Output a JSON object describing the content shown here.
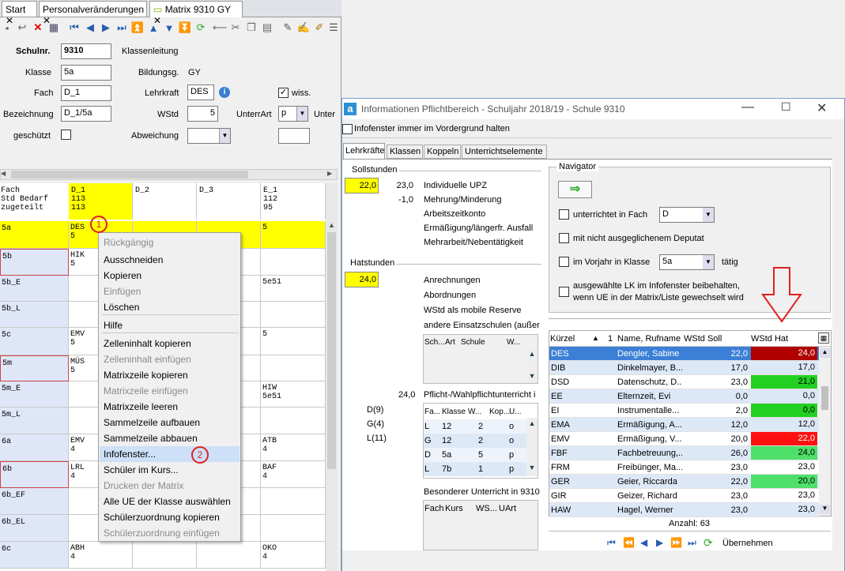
{
  "tabs": [
    "Start",
    "Personalveränderungen",
    "Matrix 9310 GY"
  ],
  "form": {
    "schulnr_label": "Schulnr.",
    "schulnr": "9310",
    "klassenleitung": "Klassenleitung",
    "klasse_label": "Klasse",
    "klasse": "5a",
    "bildungsg_label": "Bildungsg.",
    "bildungsg": "GY",
    "fach_label": "Fach",
    "fach": "D_1",
    "lehrkraft_label": "Lehrkraft",
    "lehrkraft": "DES",
    "wiss": "wiss.",
    "bezeichnung_label": "Bezeichnung",
    "bezeichnung": "D_1/5a",
    "wstd_label": "WStd",
    "wstd": "5",
    "unterart_label": "UnterrArt",
    "unterart": "p",
    "unter_cut": "Unter",
    "geschuetzt_label": "geschützt",
    "abweichung_label": "Abweichung"
  },
  "matrix": {
    "row_header": [
      "Fach",
      "Std Bedarf",
      "zugeteilt"
    ],
    "columns": [
      {
        "name": "D_1",
        "bedarf": "113",
        "zugeteilt": "113"
      },
      {
        "name": "D_2",
        "bedarf": "",
        "zugeteilt": ""
      },
      {
        "name": "D_3",
        "bedarf": "",
        "zugeteilt": ""
      },
      {
        "name": "E_1",
        "bedarf": "112",
        "zugeteilt": "95"
      }
    ],
    "rows": [
      {
        "k": "5a",
        "c1a": "DES",
        "c1b": "5",
        "c4a": "5",
        "c4b": ""
      },
      {
        "k": "5b",
        "c1a": "HIK",
        "c1b": "5",
        "c4a": "",
        "c4b": ""
      },
      {
        "k": "5b_E",
        "c1a": "",
        "c1b": "",
        "c4a": "5e51",
        "c4b": ""
      },
      {
        "k": "5b_L",
        "c1a": "",
        "c1b": "",
        "c4a": "",
        "c4b": ""
      },
      {
        "k": "5c",
        "c1a": "EMV",
        "c1b": "5",
        "c4a": "5",
        "c4b": ""
      },
      {
        "k": "5m",
        "c1a": "MÜS",
        "c1b": "5",
        "c4a": "",
        "c4b": ""
      },
      {
        "k": "5m_E",
        "c1a": "",
        "c1b": "",
        "c4a": "HIW",
        "c4b": "5e51"
      },
      {
        "k": "5m_L",
        "c1a": "",
        "c1b": "",
        "c4a": "",
        "c4b": ""
      },
      {
        "k": "6a",
        "c1a": "EMV",
        "c1b": "4",
        "c4a": "ATB",
        "c4b": "4"
      },
      {
        "k": "6b",
        "c1a": "LRL",
        "c1b": "4",
        "c4a": "BAF",
        "c4b": "4"
      },
      {
        "k": "6b_EF",
        "c1a": "",
        "c1b": "",
        "c4a": "",
        "c4b": ""
      },
      {
        "k": "6b_EL",
        "c1a": "",
        "c1b": "",
        "c4a": "",
        "c4b": ""
      },
      {
        "k": "6c",
        "c1a": "ABH",
        "c1b": "4",
        "c4a": "OKO",
        "c4b": "4"
      }
    ]
  },
  "context_menu": [
    {
      "label": "Rückgängig",
      "disabled": true
    },
    {
      "label": "Ausschneiden",
      "disabled": false
    },
    {
      "label": "Kopieren",
      "disabled": false
    },
    {
      "label": "Einfügen",
      "disabled": true
    },
    {
      "label": "Löschen",
      "disabled": false
    },
    {
      "label": "Hilfe",
      "disabled": false
    },
    {
      "label": "Zelleninhalt kopieren",
      "disabled": false
    },
    {
      "label": "Zelleninhalt einfügen",
      "disabled": true
    },
    {
      "label": "Matrixzeile kopieren",
      "disabled": false
    },
    {
      "label": "Matrixzeile einfügen",
      "disabled": true
    },
    {
      "label": "Matrixzeile leeren",
      "disabled": false
    },
    {
      "label": "Sammelzeile aufbauen",
      "disabled": false
    },
    {
      "label": "Sammelzeile abbauen",
      "disabled": false
    },
    {
      "label": "Infofenster...",
      "disabled": false
    },
    {
      "label": "Schüler im Kurs...",
      "disabled": false
    },
    {
      "label": "Drucken der Matrix",
      "disabled": true
    },
    {
      "label": "Alle UE der Klasse auswählen",
      "disabled": false
    },
    {
      "label": "Schülerzuordnung kopieren",
      "disabled": false
    },
    {
      "label": "Schülerzuordnung einfügen",
      "disabled": true
    }
  ],
  "badges": [
    "1",
    "2"
  ],
  "info": {
    "title": "Informationen Pflichtbereich - Schuljahr 2018/19 - Schule 9310",
    "app_icon": "a",
    "always_front": "Infofenster immer im Vordergrund halten",
    "tabs": [
      "Lehrkräfte",
      "Klassen",
      "Koppeln",
      "Unterrichtselemente"
    ],
    "soll_title": "Sollstunden",
    "soll_value": "22,0",
    "soll_items": [
      {
        "v": "23,0",
        "l": "Individuelle UPZ"
      },
      {
        "v": "-1,0",
        "l": "Mehrung/Minderung"
      },
      {
        "v": "",
        "l": "Arbeitszeitkonto"
      },
      {
        "v": "",
        "l": "Ermäßigung/längerfr. Ausfall"
      },
      {
        "v": "",
        "l": "Mehrarbeit/Nebentätigkeit"
      }
    ],
    "hat_title": "Hatstunden",
    "hat_value": "24,0",
    "hat_items": [
      "Anrechnungen",
      "Abordnungen",
      "WStd als mobile Reserve",
      "andere Einsatzschulen (außer"
    ],
    "ext_headers": [
      "Sch...",
      "Art",
      "Schule",
      "W..."
    ],
    "pw_value": "24,0",
    "pw_label": "Pflicht-/Wahlpflichtunterricht i",
    "pw_counts": [
      "D(9)",
      "G(4)",
      "L(11)"
    ],
    "pw_headers": [
      "Fa...",
      "Klasse",
      "W...",
      "Kop...",
      "U..."
    ],
    "pw_rows": [
      [
        "L",
        "12",
        "2",
        "o"
      ],
      [
        "G",
        "12",
        "2",
        "o"
      ],
      [
        "D",
        "5a",
        "5",
        "p"
      ],
      [
        "L",
        "7b",
        "1",
        "p"
      ]
    ],
    "bes_label": "Besonderer Unterricht in 9310",
    "bes_headers": [
      "Fach",
      "Kurs",
      "WS...",
      "UArt"
    ],
    "nav_title": "Navigator",
    "opt1": "unterrichtet in Fach",
    "opt1_val": "D",
    "opt2": "mit nicht ausgeglichenem Deputat",
    "opt3": "im Vorjahr in Klasse",
    "opt3_val": "5a",
    "opt3_suffix": "tätig",
    "opt4a": "ausgewählte LK im Infofenster beibehalten,",
    "opt4b": "wenn UE in der Matrix/Liste gewechselt wird",
    "grid_headers": [
      "Kürzel",
      "1",
      "Name, Rufname",
      "WStd Soll",
      "WStd Hat"
    ],
    "grid": [
      {
        "k": "DES",
        "n": "Dengler, Sabine",
        "s": "22,0",
        "h": "24,0",
        "c": "#b00000",
        "sel": true
      },
      {
        "k": "DIB",
        "n": "Dinkelmayer, B...",
        "s": "17,0",
        "h": "17,0",
        "c": ""
      },
      {
        "k": "DSD",
        "n": "Datenschutz, D...",
        "s": "23,0",
        "h": "21,0",
        "c": "#22d022"
      },
      {
        "k": "EE",
        "n": "Elternzeit, Evi",
        "s": "0,0",
        "h": "0,0",
        "c": ""
      },
      {
        "k": "EI",
        "n": "Instrumentalle...",
        "s": "2,0",
        "h": "0,0",
        "c": "#22d022"
      },
      {
        "k": "EMA",
        "n": "Ermäßigung, A...",
        "s": "12,0",
        "h": "12,0",
        "c": ""
      },
      {
        "k": "EMV",
        "n": "Ermäßigung, V...",
        "s": "20,0",
        "h": "22,0",
        "c": "#ff1010"
      },
      {
        "k": "FBF",
        "n": "Fachbetreuung,...",
        "s": "26,0",
        "h": "24,0",
        "c": "#4ee06a"
      },
      {
        "k": "FRM",
        "n": "Freibünger, Ma...",
        "s": "23,0",
        "h": "23,0",
        "c": ""
      },
      {
        "k": "GER",
        "n": "Geier, Riccarda",
        "s": "22,0",
        "h": "20,0",
        "c": "#4ee06a"
      },
      {
        "k": "GIR",
        "n": "Geizer, Richard",
        "s": "23,0",
        "h": "23,0",
        "c": ""
      },
      {
        "k": "HAW",
        "n": "Hagel, Werner",
        "s": "23,0",
        "h": "23,0",
        "c": ""
      }
    ],
    "anzahl": "Anzahl: 63",
    "uebernehmen": "Übernehmen"
  }
}
